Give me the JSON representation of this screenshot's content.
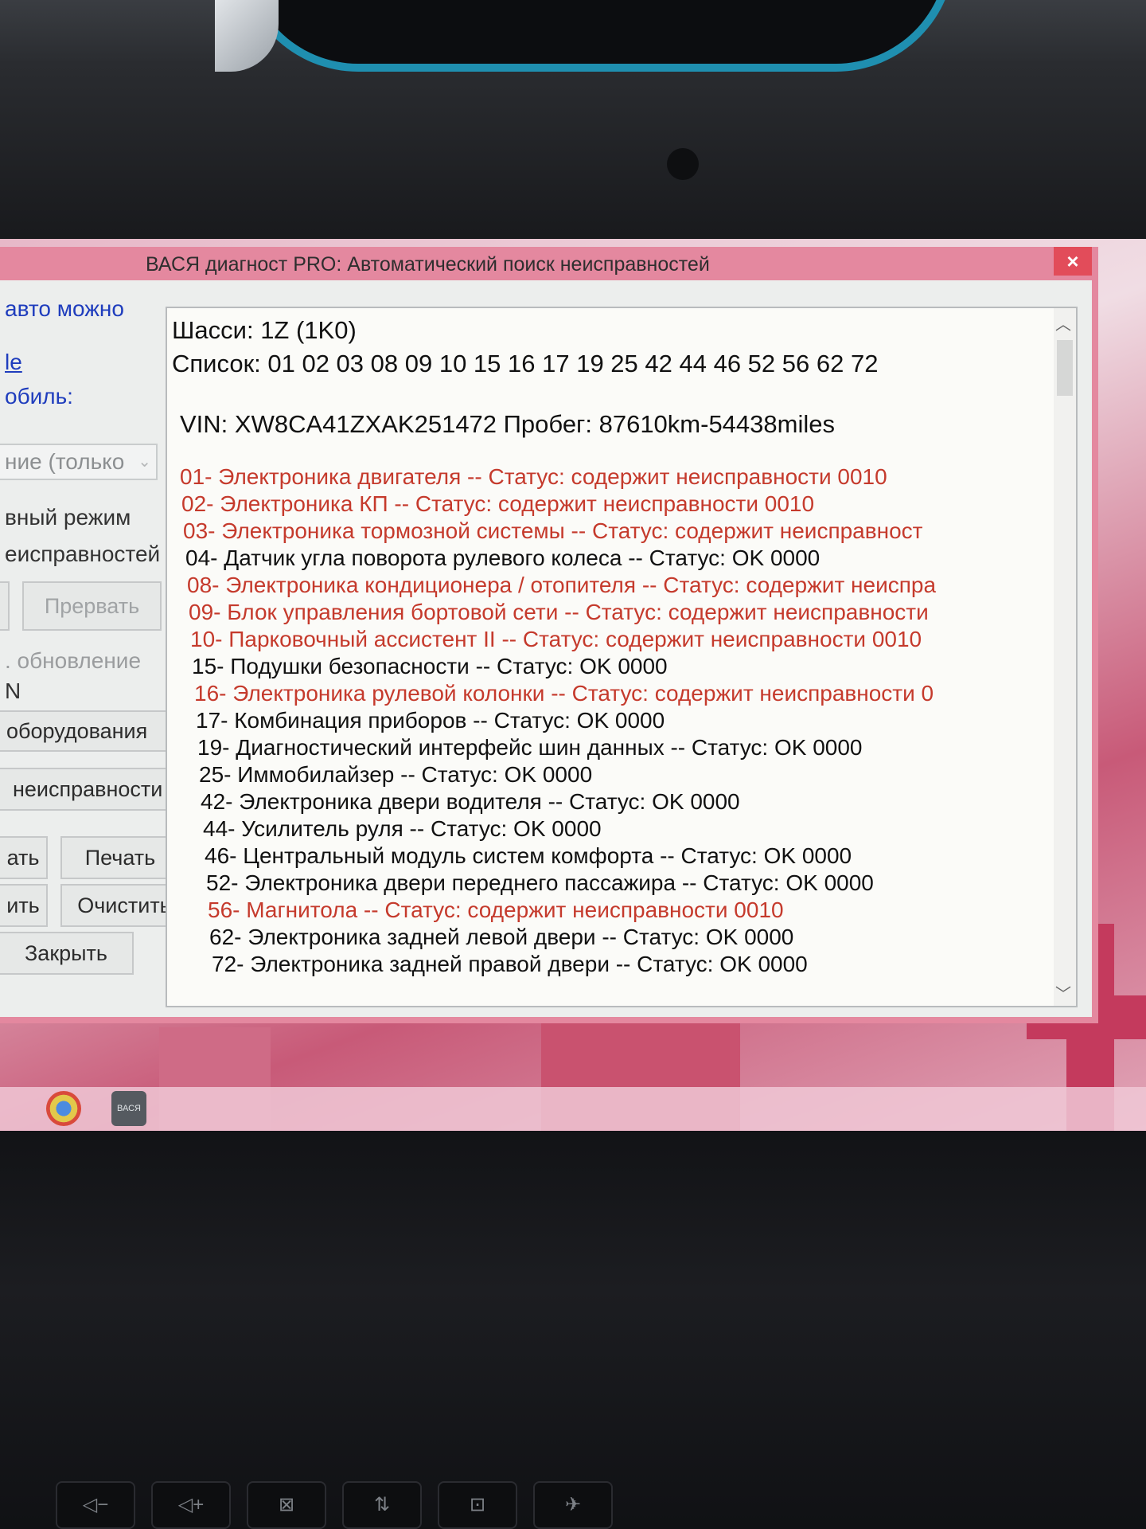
{
  "window": {
    "title": "ВАСЯ диагност PRO:  Автоматический поиск неисправностей",
    "close_label": "×"
  },
  "left_panel": {
    "text_1": "авто можно",
    "link": "le",
    "text_2": "обиль:",
    "select_value": "ние (только",
    "text_3": "вный режим",
    "text_4": "еисправностей",
    "interrupt_button": "Прервать",
    "text_update": ". обновление",
    "text_n": "N",
    "equipment_button": "оборудования",
    "faults_button": "неисправности",
    "save_button_cut": "ать",
    "print_button": "Печать",
    "clear_button_cut": "ить",
    "clear_button": "Очистить",
    "close_button": "Закрыть"
  },
  "results": {
    "chassis": "Шасси: 1Z (1K0)",
    "list": "Список: 01 02 03 08 09 10 15 16 17 19 25 42 44 46 52 56 62 72",
    "vin": "VIN: XW8CA41ZXAK251472    Пробег: 87610km-54438miles",
    "modules": [
      {
        "text": "01- Электроника двигателя -- Статус: содержит неисправности 0010",
        "fault": true
      },
      {
        "text": "02- Электроника КП -- Статус: содержит неисправности 0010",
        "fault": true
      },
      {
        "text": "03- Электроника тормозной системы -- Статус: содержит неисправност",
        "fault": true
      },
      {
        "text": "04- Датчик угла поворота рулевого колеса -- Статус: OK 0000",
        "fault": false
      },
      {
        "text": "08- Электроника кондиционера / отопителя -- Статус: содержит неиспра",
        "fault": true
      },
      {
        "text": "09- Блок управления бортовой сети -- Статус: содержит неисправности",
        "fault": true
      },
      {
        "text": "10- Парковочный ассистент II -- Статус: содержит неисправности 0010",
        "fault": true
      },
      {
        "text": "15- Подушки безопасности -- Статус: OK 0000",
        "fault": false
      },
      {
        "text": "16- Электроника рулевой колонки -- Статус: содержит неисправности 0",
        "fault": true
      },
      {
        "text": "17- Комбинация приборов -- Статус: OK 0000",
        "fault": false
      },
      {
        "text": "19- Диагностический интерфейс шин данных -- Статус: OK 0000",
        "fault": false
      },
      {
        "text": "25- Иммобилайзер -- Статус: OK 0000",
        "fault": false
      },
      {
        "text": "42- Электроника двери водителя -- Статус: OK 0000",
        "fault": false
      },
      {
        "text": "44- Усилитель руля -- Статус: OK 0000",
        "fault": false
      },
      {
        "text": "46- Центральный модуль систем комфорта -- Статус: OK 0000",
        "fault": false
      },
      {
        "text": "52- Электроника двери переднего пассажира -- Статус: OK 0000",
        "fault": false
      },
      {
        "text": "56- Магнитола -- Статус: содержит неисправности 0010",
        "fault": true
      },
      {
        "text": "62- Электроника задней левой двери -- Статус: OK 0000",
        "fault": false
      },
      {
        "text": "72- Электроника задней правой двери -- Статус: OK 0000",
        "fault": false
      }
    ]
  },
  "taskbar": {
    "vasya_icon_label": "ВАСЯ"
  },
  "keyboard": {
    "keys": [
      "◁−",
      "◁+",
      "⊠",
      "⇅",
      "⊡",
      "✈"
    ]
  },
  "colors": {
    "fault": "#c53a2c",
    "ok": "#111111",
    "titlebar": "#e4889f",
    "link": "#1f3dbd"
  }
}
